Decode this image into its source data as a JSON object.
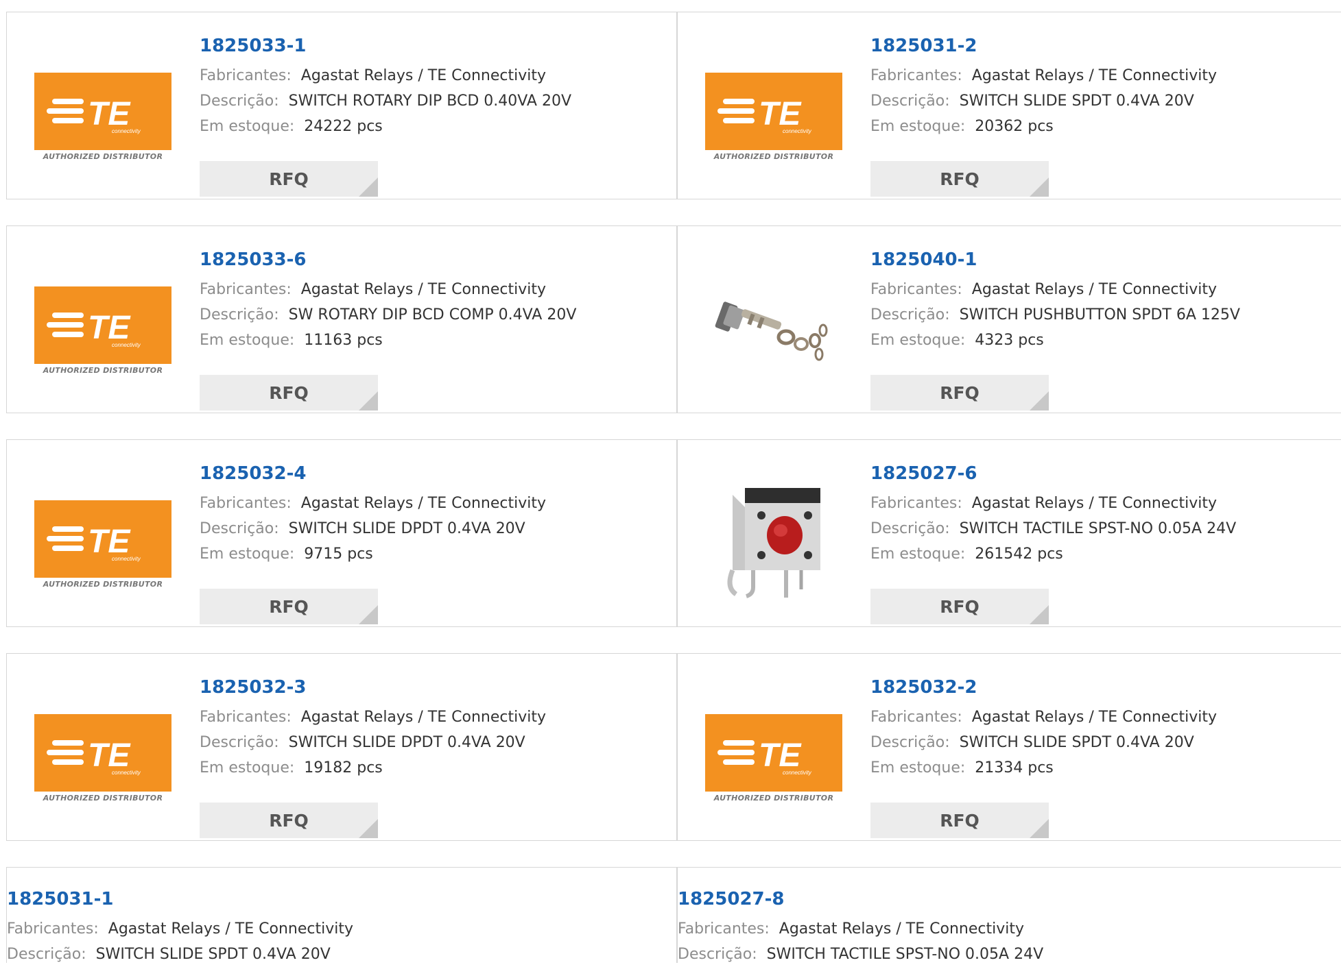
{
  "labels": {
    "manufacturer": "Fabricantes:",
    "description": "Descrição:",
    "stock": "Em estoque:",
    "rfq": "RFQ"
  },
  "logo": {
    "mark": "TE",
    "sub": "connectivity",
    "caption": "AUTHORIZED DISTRIBUTOR",
    "color": "#f39120"
  },
  "products": [
    {
      "part": "1825033-1",
      "manufacturer": "Agastat Relays / TE Connectivity",
      "description": "SWITCH ROTARY DIP BCD 0.40VA 20V",
      "stock": "24222 pcs",
      "image": "te-logo"
    },
    {
      "part": "1825031-2",
      "manufacturer": "Agastat Relays / TE Connectivity",
      "description": "SWITCH SLIDE SPDT 0.4VA 20V",
      "stock": "20362 pcs",
      "image": "te-logo"
    },
    {
      "part": "1825033-6",
      "manufacturer": "Agastat Relays / TE Connectivity",
      "description": "SW ROTARY DIP BCD COMP 0.4VA 20V",
      "stock": "11163 pcs",
      "image": "te-logo"
    },
    {
      "part": "1825040-1",
      "manufacturer": "Agastat Relays / TE Connectivity",
      "description": "SWITCH PUSHBUTTON SPDT 6A 125V",
      "stock": "4323 pcs",
      "image": "pushbutton-photo"
    },
    {
      "part": "1825032-4",
      "manufacturer": "Agastat Relays / TE Connectivity",
      "description": "SWITCH SLIDE DPDT 0.4VA 20V",
      "stock": "9715 pcs",
      "image": "te-logo"
    },
    {
      "part": "1825027-6",
      "manufacturer": "Agastat Relays / TE Connectivity",
      "description": "SWITCH TACTILE SPST-NO 0.05A 24V",
      "stock": "261542 pcs",
      "image": "tactile-photo"
    },
    {
      "part": "1825032-3",
      "manufacturer": "Agastat Relays / TE Connectivity",
      "description": "SWITCH SLIDE DPDT 0.4VA 20V",
      "stock": "19182 pcs",
      "image": "te-logo"
    },
    {
      "part": "1825032-2",
      "manufacturer": "Agastat Relays / TE Connectivity",
      "description": "SWITCH SLIDE SPDT 0.4VA 20V",
      "stock": "21334 pcs",
      "image": "te-logo"
    },
    {
      "part": "1825031-1",
      "manufacturer": "Agastat Relays / TE Connectivity",
      "description": "SWITCH SLIDE SPDT 0.4VA 20V",
      "image": "none"
    },
    {
      "part": "1825027-8",
      "manufacturer": "Agastat Relays / TE Connectivity",
      "description": "SWITCH TACTILE SPST-NO 0.05A 24V",
      "image": "none"
    }
  ]
}
